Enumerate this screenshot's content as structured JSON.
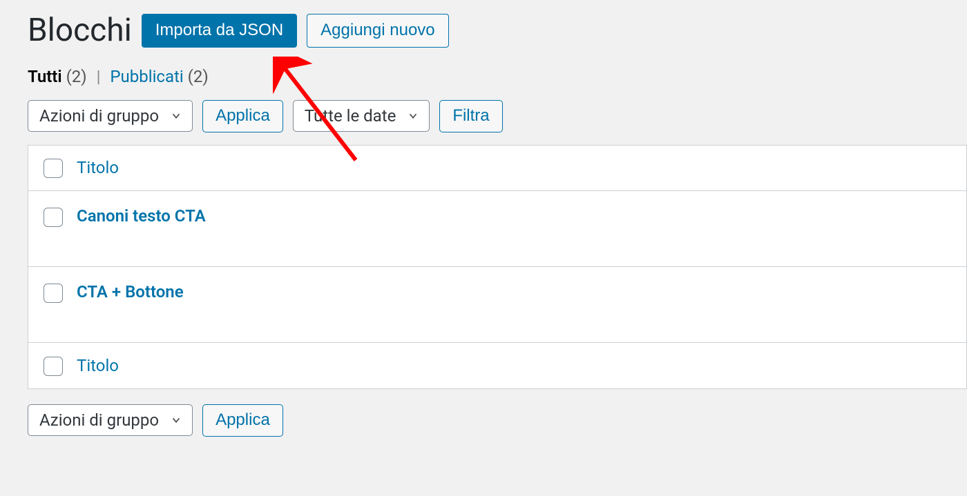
{
  "header": {
    "title": "Blocchi",
    "import_label": "Importa da JSON",
    "add_new_label": "Aggiungi nuovo"
  },
  "filters": {
    "all_label": "Tutti",
    "all_count": "(2)",
    "published_label": "Pubblicati",
    "published_count": "(2)"
  },
  "toolbar": {
    "bulk_label": "Azioni di gruppo",
    "apply_label": "Applica",
    "dates_label": "Tutte le date",
    "filter_label": "Filtra"
  },
  "table": {
    "title_header": "Titolo",
    "rows": [
      {
        "title": "Canoni testo CTA"
      },
      {
        "title": "CTA + Bottone"
      }
    ],
    "title_footer": "Titolo"
  },
  "toolbar_bottom": {
    "bulk_label": "Azioni di gruppo",
    "apply_label": "Applica"
  }
}
